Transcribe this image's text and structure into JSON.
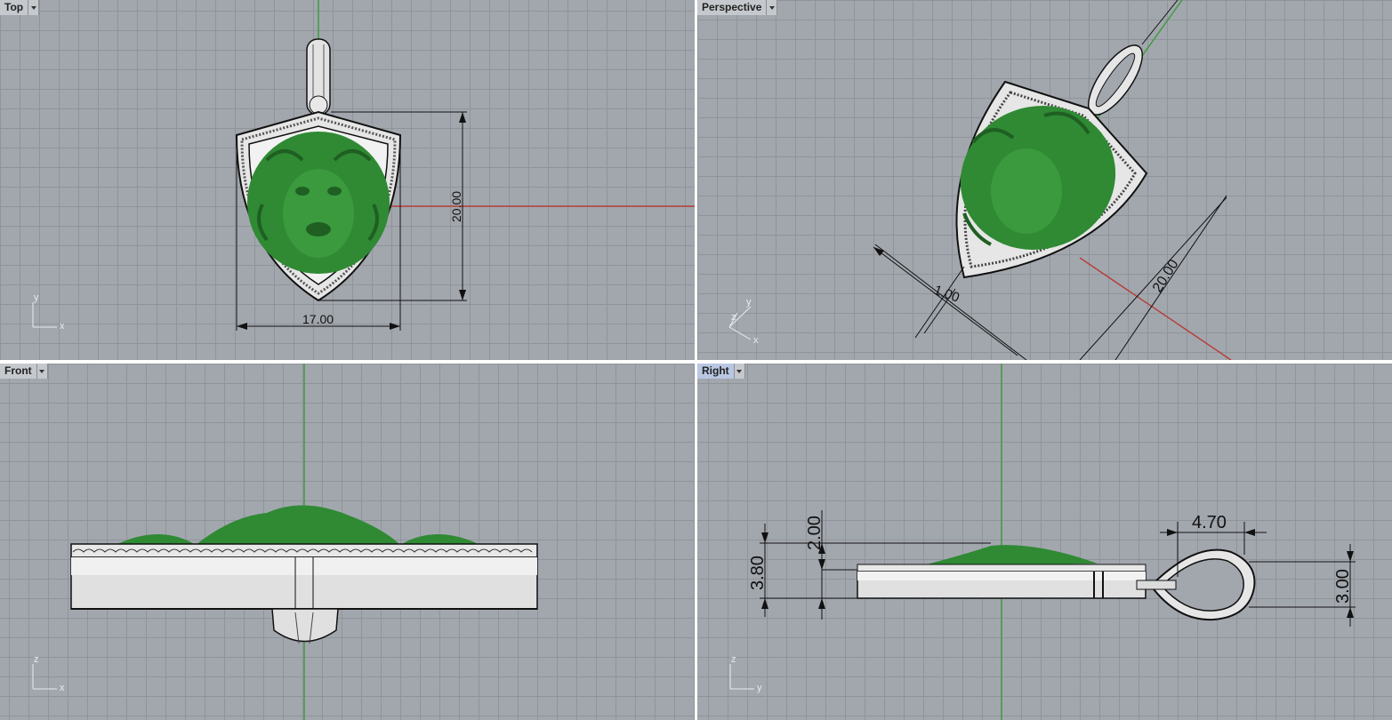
{
  "viewports": {
    "top": {
      "title": "Top",
      "dimensions": {
        "height": "20.00",
        "width": "17.00"
      },
      "axes": {
        "vertical": "y",
        "horizontal": "x"
      }
    },
    "perspective": {
      "title": "Perspective",
      "dimensions": {
        "length": "20.00",
        "thickness": "1.00"
      },
      "axes": {
        "a": "z",
        "b": "y",
        "c": "x"
      }
    },
    "front": {
      "title": "Front",
      "axes": {
        "vertical": "z",
        "horizontal": "x"
      }
    },
    "right": {
      "title": "Right",
      "active": true,
      "dimensions": {
        "total_thickness": "3.80",
        "relief_height": "2.00",
        "bail_length": "4.70",
        "bail_height": "3.00"
      },
      "axes": {
        "vertical": "z",
        "horizontal": "y"
      }
    }
  },
  "colors": {
    "viewport_bg": "#a2a7ae",
    "grid": "#8f949a",
    "x_axis": "#b5413a",
    "y_axis": "#3f9b3f",
    "relief_green": "#2f8a33",
    "metal": "#e6e6e6",
    "active_tab": "#b9c7e2"
  },
  "icons": [
    "viewport-menu-dropdown-icon",
    "axis-gizmo-icon"
  ]
}
